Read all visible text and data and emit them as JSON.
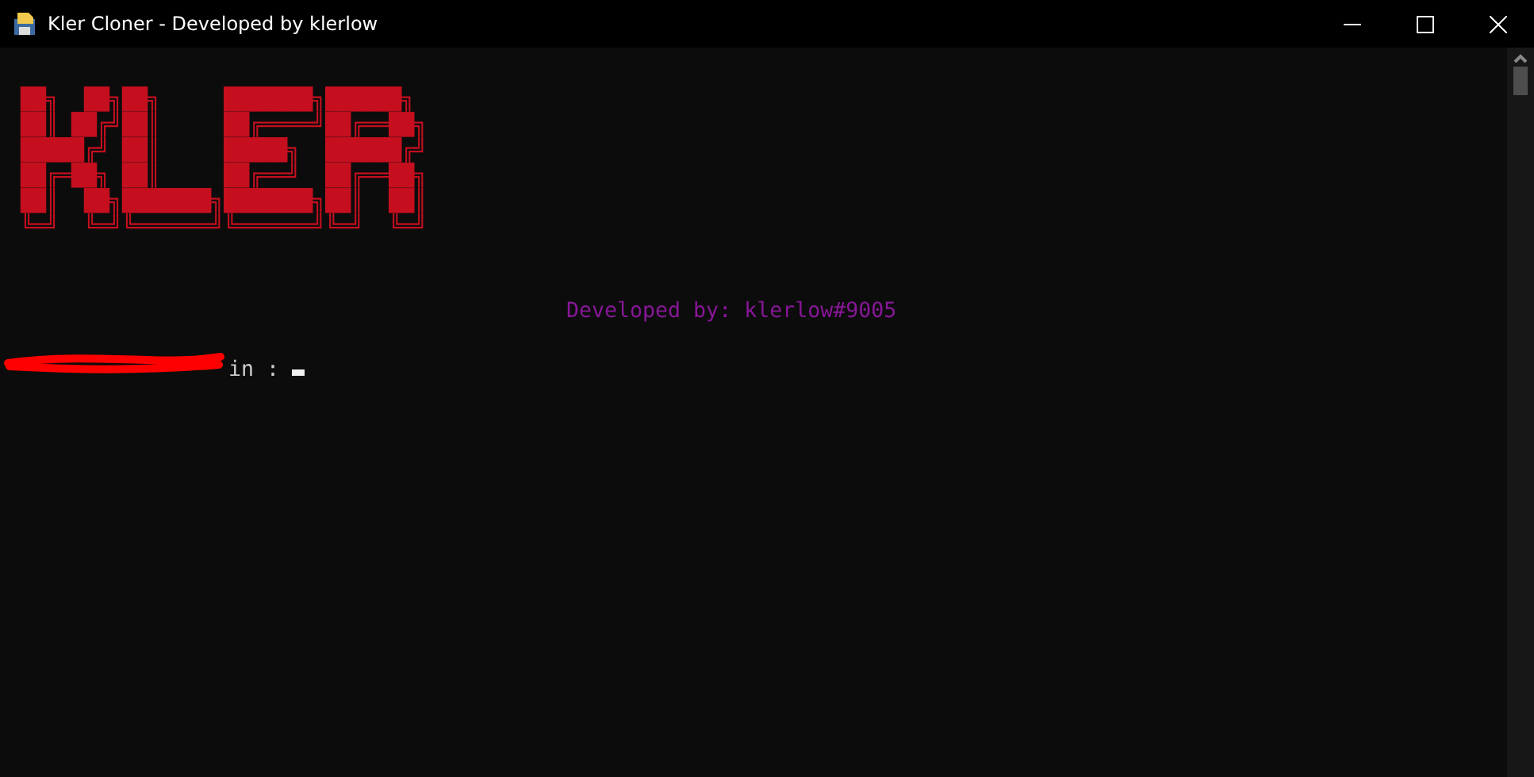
{
  "window": {
    "title": "Kler Cloner - Developed by klerlow"
  },
  "console": {
    "logo_lines": [
      "██╗  ██╗██╗     ███████╗██████╗ ",
      "██║ ██╔╝██║     ██╔════╝██╔══██╗",
      "█████╔╝ ██║     █████╗  ██████╔╝",
      "██╔═██╗ ██║     ██╔══╝  ██╔══██╗",
      "██║  ██╗███████╗███████╗██║  ██║",
      "╚═╝  ╚═╝╚══════╝╚══════╝╚═╝  ╚═╝"
    ],
    "credit": {
      "text": "Developed by: klerlow#9005"
    },
    "prompt": {
      "text": "in :",
      "redacted": true
    }
  }
}
